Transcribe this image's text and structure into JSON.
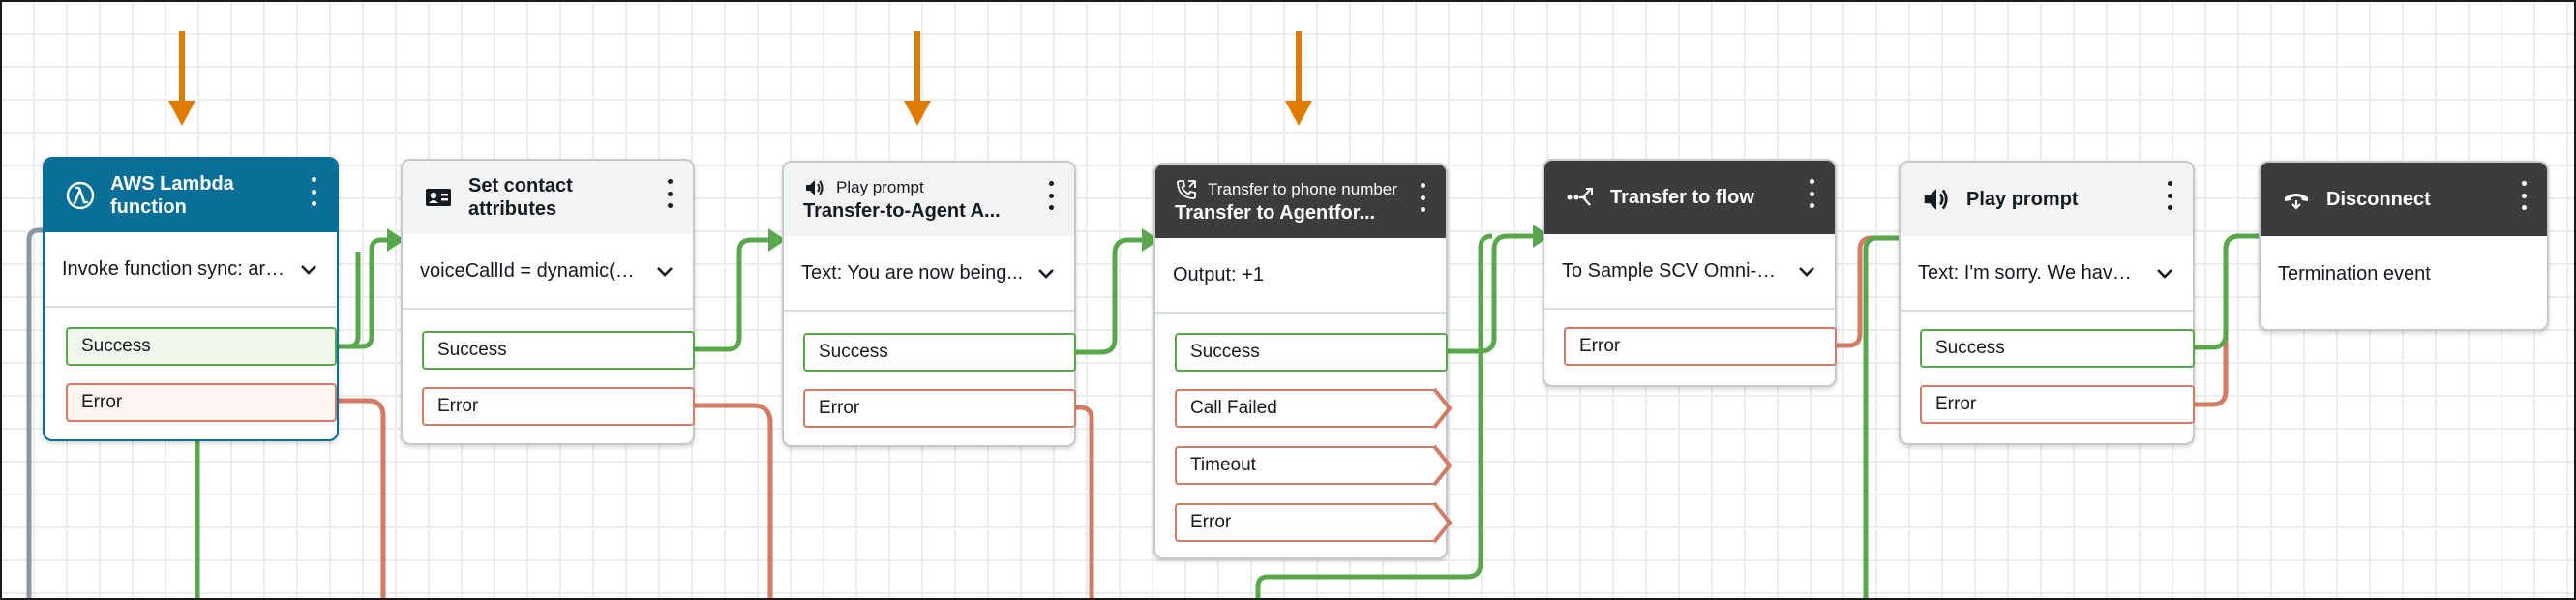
{
  "colors": {
    "success_wire": "#58a84b",
    "error_wire": "#d27b65",
    "entry_wire": "#8a96a3",
    "selected_header": "#0a6f98",
    "dark_header": "#3c3c3c",
    "indicator_arrow": "#e07b00"
  },
  "blocks": [
    {
      "title": "AWS Lambda function",
      "subtitle": "",
      "icon": "lambda-icon",
      "summary": "Invoke function sync: arn...",
      "branches": [
        "Success",
        "Error"
      ]
    },
    {
      "title": "Set contact attributes",
      "subtitle": "",
      "icon": "contact-card-icon",
      "summary": "voiceCallId = dynamic(Ext...",
      "branches": [
        "Success",
        "Error"
      ]
    },
    {
      "title": "Transfer-to-Agent A...",
      "subtitle": "Play prompt",
      "icon": "speaker-icon",
      "summary": "Text: You are now being...",
      "branches": [
        "Success",
        "Error"
      ]
    },
    {
      "title": "Transfer to Agentfor...",
      "subtitle": "Transfer to phone number",
      "icon": "phone-transfer-icon",
      "summary": "Output: +1",
      "branches": [
        "Success",
        "Call Failed",
        "Timeout",
        "Error"
      ]
    },
    {
      "title": "Transfer to flow",
      "subtitle": "",
      "icon": "flow-transfer-icon",
      "summary": "To Sample SCV Omni-Ch...",
      "branches": [
        "Error"
      ]
    },
    {
      "title": "Play prompt",
      "subtitle": "",
      "icon": "speaker-icon",
      "summary": "Text: I'm sorry. We have ...",
      "branches": [
        "Success",
        "Error"
      ]
    },
    {
      "title": "Disconnect",
      "subtitle": "",
      "icon": "hang-up-icon",
      "summary": "Termination event",
      "branches": []
    }
  ]
}
